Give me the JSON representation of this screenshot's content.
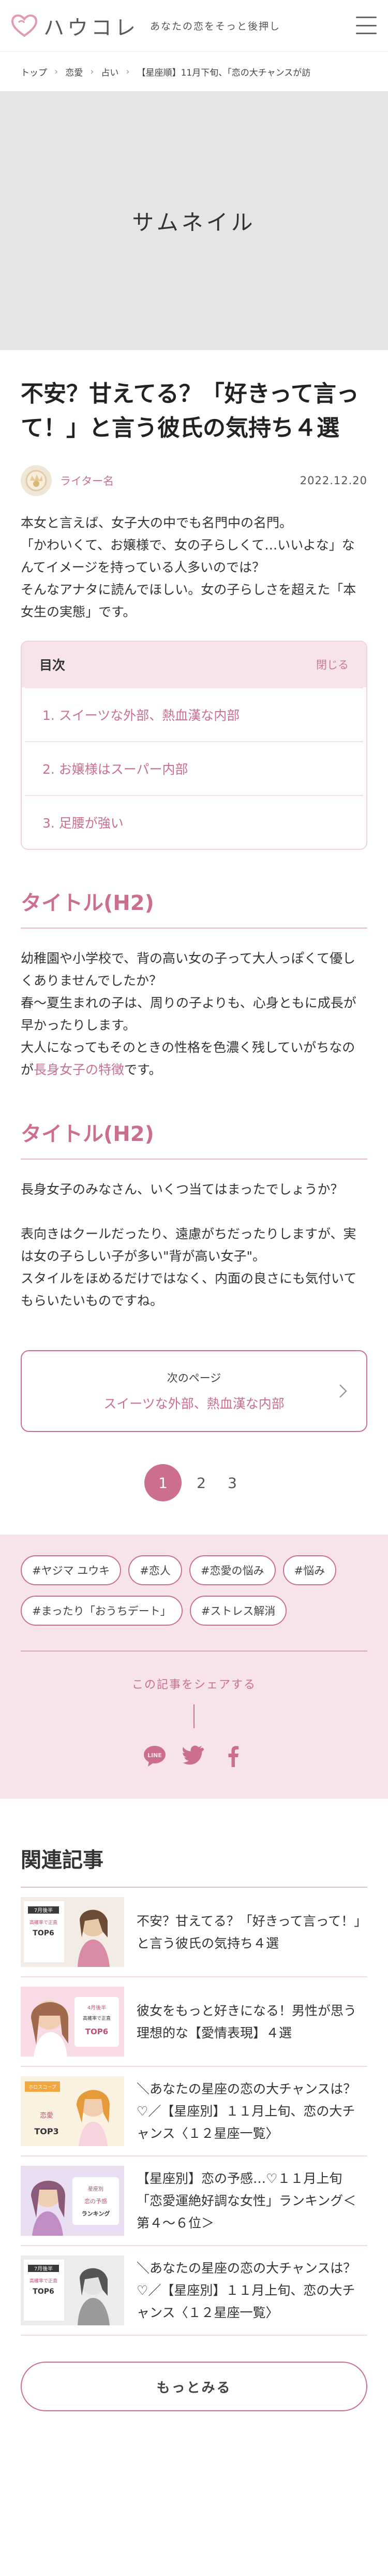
{
  "header": {
    "logo_text": "ハウコレ",
    "tagline": "あなたの恋をそっと後押し"
  },
  "breadcrumb": [
    "トップ",
    "恋愛",
    "占い",
    "【星座順】11月下旬、「恋の大チャンスが訪"
  ],
  "thumbnail": {
    "label": "サムネイル"
  },
  "article": {
    "title": "不安？甘えてる？「好きって言って！」と言う彼氏の気持ち４選",
    "author": "ライター名",
    "date": "2022.12.20",
    "lead": [
      "本女と言えば、女子大の中でも名門中の名門。",
      "「かわいくて、お嬢様で、女の子らしくて…いいよな」なんてイメージを持っている人多いのでは？",
      "そんなアナタに読んでほしい。女の子らしさを超えた「本女生の実態」です。"
    ]
  },
  "toc": {
    "title": "目次",
    "close_label": "閉じる",
    "items": [
      "1. スイーツな外部、熱血漢な内部",
      "2. お嬢様はスーパー内部",
      "3. 足腰が強い"
    ]
  },
  "sections": [
    {
      "heading": "タイトル(H2)",
      "p1": "幼稚園や小学校で、背の高い女の子って大人っぽくて優しくありませんでしたか？",
      "p2": "春〜夏生まれの子は、周りの子よりも、心身ともに成長が早かったりします。",
      "p3_pre": "大人になってもそのときの性格を色濃く残していがちなのが",
      "p3_link": "長身女子の特徴",
      "p3_post": "です。"
    },
    {
      "heading": "タイトル(H2)",
      "p1": "長身女子のみなさん、いくつ当てはまったでしょうか？",
      "p2": "表向きはクールだったり、遠慮がちだったりしますが、実は女の子らしい子が多い\"背が高い女子\"。",
      "p3": "スタイルをほめるだけではなく、内面の良さにも気付いてもらいたいものですね。"
    }
  ],
  "next_page": {
    "label": "次のページ",
    "title": "スイーツな外部、熱血漢な内部"
  },
  "pagination": {
    "pages": [
      "1",
      "2",
      "3"
    ],
    "current": "1"
  },
  "tags": [
    "#ヤジマ ユウキ",
    "#恋人",
    "#恋愛の悩み",
    "#悩み",
    "#まったり「おうちデート」",
    "#ストレス解消"
  ],
  "share": {
    "title": "この記事をシェアする",
    "icons": [
      "line-icon",
      "twitter-icon",
      "facebook-icon"
    ],
    "line_label": "LINE"
  },
  "related": {
    "title": "関連記事",
    "items": [
      "不安？甘えてる？「好きって言って！」と言う彼氏の気持ち４選",
      "彼女をもっと好きになる！男性が思う理想的な【愛情表現】４選",
      "＼あなたの星座の恋の大チャンスは？♡／【星座別】１１月上旬、恋の大チャンス〈１２星座一覧〉",
      "【星座別】恋の予感…♡１１月上旬「恋愛運絶好調な女性」ランキング＜第４〜６位＞",
      "＼あなたの星座の恋の大チャンスは？♡／【星座別】１１月上旬、恋の大チャンス〈１２星座一覧〉"
    ],
    "thumb_labels": [
      [
        "7月後半",
        "高確率で正直",
        "TOP6"
      ],
      [
        "4月後半",
        "高確率で正直",
        "TOP6"
      ],
      [
        "ホロスコープ",
        "恋愛",
        "TOP3"
      ],
      [
        "星座別",
        "恋の予感",
        "ランキング"
      ],
      [
        "7月後半",
        "高確率で正直",
        "TOP6"
      ]
    ]
  },
  "more_button": {
    "label": "もっとみる"
  },
  "colors": {
    "accent": "#cc6f8c",
    "accent_light": "#f6e4ea",
    "placeholder_gray": "#e5e5e5"
  }
}
